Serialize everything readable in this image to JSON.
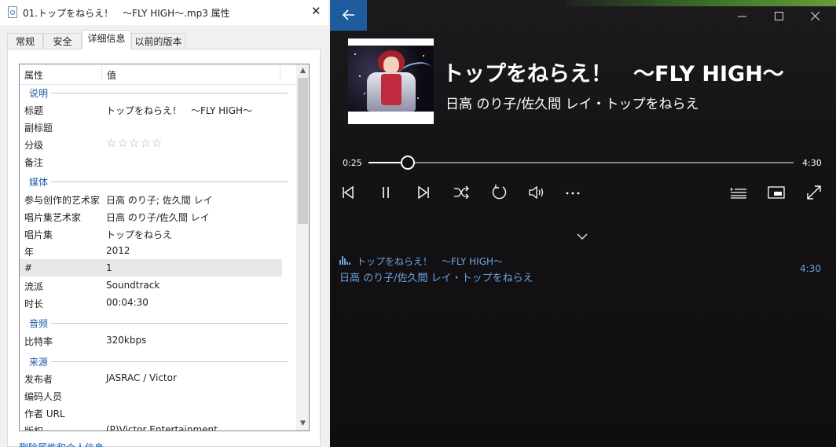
{
  "properties": {
    "window_title": "01.トップをねらえ！　～FLY HIGH～.mp3 属性",
    "tabs": [
      "常规",
      "安全",
      "详细信息",
      "以前的版本"
    ],
    "active_tab": "详细信息",
    "columns": {
      "property": "属性",
      "value": "值"
    },
    "groups": {
      "description": "说明",
      "media": "媒体",
      "audio": "音频",
      "origin": "来源"
    },
    "rows": {
      "title": {
        "label": "标题",
        "value": "トップをねらえ！　～FLY HIGH～"
      },
      "subtitle": {
        "label": "副标题",
        "value": ""
      },
      "rating": {
        "label": "分级",
        "stars": "☆☆☆☆☆",
        "value": 0
      },
      "comments": {
        "label": "备注",
        "value": ""
      },
      "contributing_artists": {
        "label": "参与创作的艺术家",
        "value": "日高 のり子; 佐久間 レイ"
      },
      "album_artist": {
        "label": "唱片集艺术家",
        "value": "日高 のり子/佐久間 レイ"
      },
      "album": {
        "label": "唱片集",
        "value": "トップをねらえ"
      },
      "year": {
        "label": "年",
        "value": "2012"
      },
      "track": {
        "label": "#",
        "value": "1"
      },
      "genre": {
        "label": "流派",
        "value": "Soundtrack"
      },
      "length": {
        "label": "时长",
        "value": "00:04:30"
      },
      "bitrate": {
        "label": "比特率",
        "value": "320kbps"
      },
      "publisher": {
        "label": "发布者",
        "value": "JASRAC / Victor"
      },
      "encoded_by": {
        "label": "编码人员",
        "value": ""
      },
      "author_url": {
        "label": "作者 URL",
        "value": ""
      },
      "copyright": {
        "label": "版权",
        "value": "(P)Victor Entertainment"
      }
    },
    "remove_link": "删除属性和个人信息"
  },
  "player": {
    "song_title": "トップをねらえ！　～FLY HIGH～",
    "artist_album": "日高 のり子/佐久間 レイ・トップをねらえ",
    "current_time": "0:25",
    "total_time": "4:30",
    "progress_fraction": 0.0926,
    "queue": {
      "title": "トップをねらえ！　～FLY HIGH～",
      "artist_album": "日高 のり子/佐久間 レイ・トップをねらえ",
      "duration": "4:30"
    },
    "accent_color": "#1d5d9e",
    "queue_color": "#6ca4e0"
  }
}
